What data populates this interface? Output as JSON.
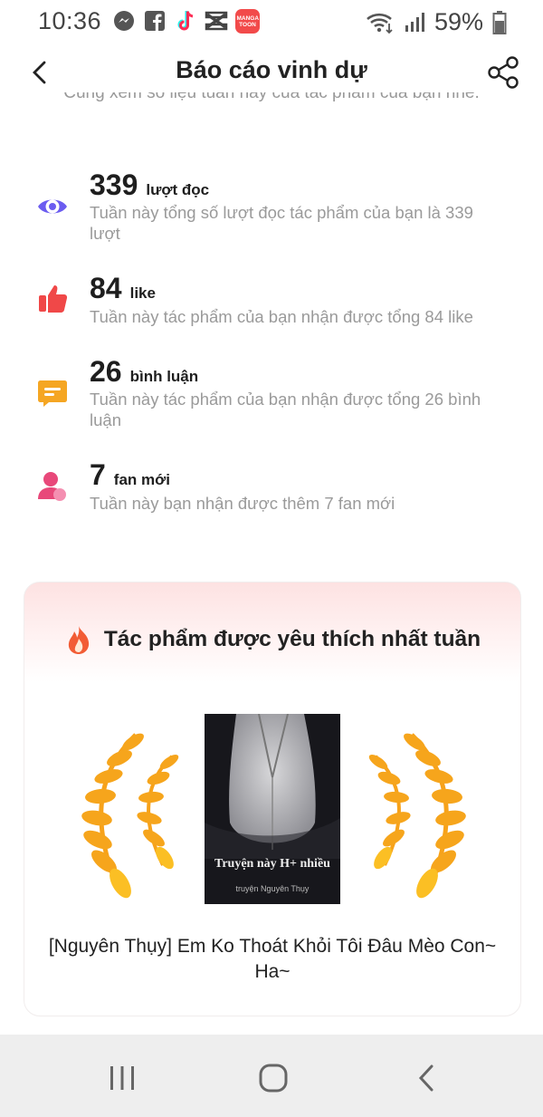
{
  "status": {
    "time": "10:36",
    "battery_percent": "59%",
    "notification_icons": [
      "messenger-icon",
      "facebook-icon",
      "tiktok-icon",
      "capcut-icon",
      "mangatoon-icon"
    ],
    "mangatoon_label": "MANGA TOON"
  },
  "header": {
    "title": "Báo cáo vinh dự",
    "subtitle": "Cùng xem số liệu tuần này của tác phẩm của bạn nhé."
  },
  "stats": [
    {
      "icon": "eye-icon",
      "number": "339",
      "unit": "lượt đọc",
      "description": "Tuần này tổng số lượt đọc tác phẩm của bạn là 339 lượt",
      "color": "#6b5cf0"
    },
    {
      "icon": "thumbs-up-icon",
      "number": "84",
      "unit": "like",
      "description": "Tuần này tác phẩm của bạn nhận được tổng 84 like",
      "color": "#f04848"
    },
    {
      "icon": "comment-icon",
      "number": "26",
      "unit": "bình luận",
      "description": "Tuần này tác phẩm của bạn nhận được tổng 26 bình luận",
      "color": "#f5a623"
    },
    {
      "icon": "person-icon",
      "number": "7",
      "unit": "fan mới",
      "description": "Tuần này bạn nhận được thêm 7 fan mới",
      "color": "#e8487a"
    }
  ],
  "favorite": {
    "title": "Tác phẩm được yêu thích nhất tuần",
    "cover_text": "Truyện này H+ nhiều",
    "cover_author": "truyện Nguyên Thụy",
    "work_title": "[Nguyên Thụy] Em Ko Thoát Khỏi Tôi Đâu Mèo Con~ Ha~"
  },
  "nav": {
    "buttons": [
      "recent-apps-icon",
      "home-icon",
      "back-icon"
    ]
  }
}
